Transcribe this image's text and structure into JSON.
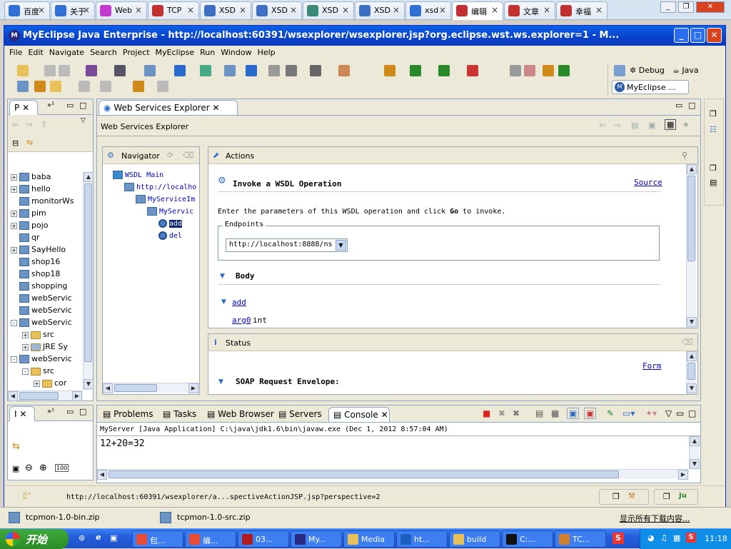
{
  "browser": {
    "tabs": [
      {
        "label": "百度",
        "color": "#2f6fd6"
      },
      {
        "label": "关于",
        "color": "#2f6fd6"
      },
      {
        "label": "Web",
        "color": "#c43ad0"
      },
      {
        "label": "TCP",
        "color": "#c23030"
      },
      {
        "label": "XSD",
        "color": "#3d6fc5"
      },
      {
        "label": "XSD",
        "color": "#3d6fc5"
      },
      {
        "label": "XSD",
        "color": "#3a8a78"
      },
      {
        "label": "XSD",
        "color": "#3d6fc5"
      },
      {
        "label": "xsd",
        "color": "#2f6fd6"
      },
      {
        "label": "编辑",
        "color": "#c23030"
      },
      {
        "label": "文章",
        "color": "#c23030"
      },
      {
        "label": "幸福",
        "color": "#c23030"
      }
    ],
    "active_tab": 9
  },
  "window": {
    "title": "MyEclipse Java Enterprise - http://localhost:60391/wsexplorer/wsexplorer.jsp?org.eclipse.wst.ws.explorer=1 - M...",
    "minimize": "_",
    "maximize": "□",
    "close": "✕"
  },
  "menu": [
    "File",
    "Edit",
    "Navigate",
    "Search",
    "Project",
    "MyEclipse",
    "Run",
    "Window",
    "Help"
  ],
  "perspectives": {
    "debug": "Debug",
    "java": "Java",
    "myeclipse": "MyEclipse ..."
  },
  "package_view": {
    "tab": "P",
    "items": [
      {
        "label": "baba",
        "type": "project",
        "exp": "+"
      },
      {
        "label": "hello",
        "type": "project",
        "exp": "+"
      },
      {
        "label": "monitorWs",
        "type": "project",
        "exp": ""
      },
      {
        "label": "pim",
        "type": "project",
        "exp": "+"
      },
      {
        "label": "pojo",
        "type": "project",
        "exp": "+"
      },
      {
        "label": "qr",
        "type": "project",
        "exp": ""
      },
      {
        "label": "SayHello",
        "type": "project",
        "exp": "+"
      },
      {
        "label": "shop16",
        "type": "project",
        "exp": ""
      },
      {
        "label": "shop18",
        "type": "project",
        "exp": ""
      },
      {
        "label": "shopping",
        "type": "project",
        "exp": ""
      },
      {
        "label": "webServic",
        "type": "project",
        "exp": ""
      },
      {
        "label": "webServic",
        "type": "project",
        "exp": ""
      },
      {
        "label": "webServic",
        "type": "project",
        "exp": "-"
      },
      {
        "label": "src",
        "type": "folder",
        "exp": "+",
        "indent": 1
      },
      {
        "label": "JRE Sy",
        "type": "lib",
        "exp": "+",
        "indent": 1
      },
      {
        "label": "webServic",
        "type": "project",
        "exp": "-"
      },
      {
        "label": "src",
        "type": "folder",
        "exp": "-",
        "indent": 1
      },
      {
        "label": "cor",
        "type": "pkg",
        "exp": "+",
        "indent": 2
      }
    ]
  },
  "outline_view": {
    "tab": "I"
  },
  "wse": {
    "tab": "Web Services Explorer",
    "header": "Web Services Explorer",
    "navigator": {
      "title": "Navigator",
      "tree": [
        {
          "label": "WSDL Main",
          "indent": 0
        },
        {
          "label": "http://localho",
          "indent": 1
        },
        {
          "label": "MyServiceIm",
          "indent": 2
        },
        {
          "label": "MyServic",
          "indent": 3
        },
        {
          "label": "add",
          "indent": 4,
          "selected": true
        },
        {
          "label": "del",
          "indent": 4
        }
      ]
    },
    "actions": {
      "title": "Actions",
      "heading": "Invoke a WSDL Operation",
      "source_link": "Source",
      "instruction_pre": "Enter the parameters of this WSDL operation and click ",
      "instruction_go": "Go",
      "instruction_post": " to invoke.",
      "endpoints_label": "Endpoints",
      "endpoint_value": "http://localhost:8888/ns",
      "body_label": "Body",
      "operation": "add",
      "arg_name": "arg0",
      "arg_type": "int"
    },
    "status": {
      "title": "Status",
      "form_link": "Form",
      "soap_label": "SOAP Request Envelope:"
    }
  },
  "console": {
    "tabs": [
      "Problems",
      "Tasks",
      "Web Browser",
      "Servers",
      "Console"
    ],
    "active": "Console",
    "process": "MyServer [Java Application] C:\\java\\jdk1.6\\bin\\javaw.exe (Dec 1, 2012 8:57:04 AM)",
    "output": "12+20=32"
  },
  "statusbar": {
    "url": "http://localhost:60391/wsexplorer/a...spectiveActionJSP.jsp?perspective=2"
  },
  "downloads": [
    {
      "label": "tcpmon-1.0-bin.zip"
    },
    {
      "label": "tcpmon-1.0-src.zip"
    }
  ],
  "downloads_show_all": "显示所有下载内容...",
  "taskbar": {
    "start": "开始",
    "tasks": [
      {
        "label": "包...",
        "color": "#e94b35"
      },
      {
        "label": "编...",
        "color": "#e94b35"
      },
      {
        "label": "03...",
        "color": "#b31c1c"
      },
      {
        "label": "My...",
        "color": "#2a2a80"
      },
      {
        "label": "Media",
        "color": "#e8c15a"
      },
      {
        "label": "ht...",
        "color": "#1c5fc0"
      },
      {
        "label": "build",
        "color": "#e8c15a"
      },
      {
        "label": "C:...",
        "color": "#111111"
      },
      {
        "label": "TC...",
        "color": "#d08030"
      }
    ],
    "clock": "11:18"
  }
}
